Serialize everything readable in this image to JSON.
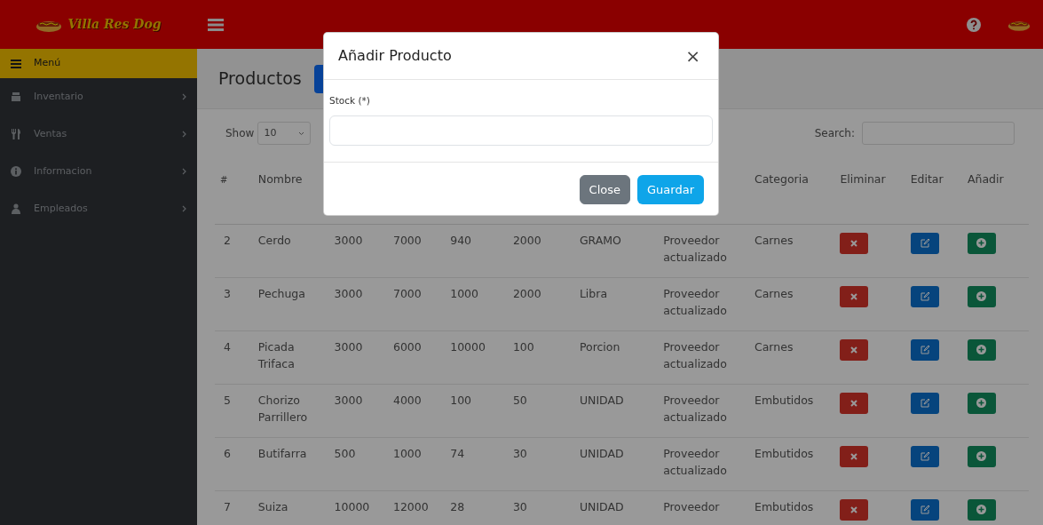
{
  "navbar": {
    "brand": "Villa Res Dog"
  },
  "sidebar": {
    "header": "Menú",
    "items": [
      {
        "label": "Inventario"
      },
      {
        "label": "Ventas"
      },
      {
        "label": "Informacion"
      },
      {
        "label": "Empleados"
      }
    ]
  },
  "page": {
    "title": "Productos"
  },
  "table_controls": {
    "show_label": "Show",
    "page_size": "10",
    "search_label": "Search:"
  },
  "table": {
    "columns": [
      {
        "label": "#"
      },
      {
        "label": "Nombre"
      },
      {},
      {},
      {},
      {},
      {},
      {},
      {
        "label": "Categoria"
      },
      {
        "label": "Eliminar"
      },
      {
        "label": "Editar"
      },
      {
        "label": "Añadir"
      }
    ],
    "rows": [
      {
        "cells": [
          "2",
          "Cerdo",
          "3000",
          "7000",
          "940",
          "2000",
          "GRAMO",
          "Proveedor actualizado",
          "Carnes"
        ]
      },
      {
        "cells": [
          "3",
          "Pechuga",
          "3000",
          "7000",
          "1000",
          "2000",
          "Libra",
          "Proveedor actualizado",
          "Carnes"
        ]
      },
      {
        "cells": [
          "4",
          "Picada Trifaca",
          "3000",
          "6000",
          "10000",
          "100",
          "Porcion",
          "Proveedor actualizado",
          "Carnes"
        ]
      },
      {
        "cells": [
          "5",
          "Chorizo Parrillero",
          "3000",
          "4000",
          "100",
          "50",
          "UNIDAD",
          "Proveedor actualizado",
          "Embutidos"
        ]
      },
      {
        "cells": [
          "6",
          "Butifarra",
          "500",
          "1000",
          "74",
          "30",
          "UNIDAD",
          "Proveedor actualizado",
          "Embutidos"
        ]
      },
      {
        "cells": [
          "7",
          "Suiza",
          "10000",
          "12000",
          "28",
          "30",
          "UNIDAD",
          "Proveedor",
          "Embutidos"
        ]
      }
    ]
  },
  "modal": {
    "title": "Añadir Producto",
    "close": "×",
    "field_label": "Stock (*)",
    "buttons": [
      {
        "label": "Close",
        "kind": "secondary"
      },
      {
        "label": "Guardar",
        "kind": "primary"
      }
    ]
  }
}
